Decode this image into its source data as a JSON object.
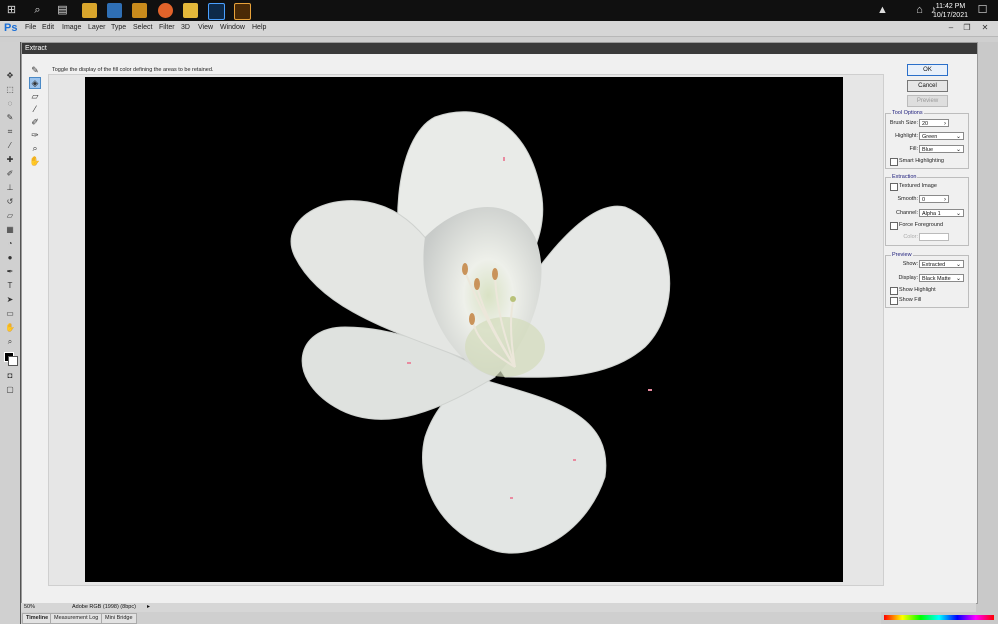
{
  "taskbar": {
    "time": "11:42 PM",
    "date": "10/17/2021"
  },
  "menubar": {
    "app_logo": "Ps",
    "items": [
      "File",
      "Edit",
      "Image",
      "Layer",
      "Type",
      "Select",
      "Filter",
      "3D",
      "View",
      "Window",
      "Help"
    ]
  },
  "dialog": {
    "title": "Extract",
    "hint": "Toggle the display of the fill color defining the areas to be retained.",
    "buttons": {
      "ok": "OK",
      "cancel": "Cancel",
      "preview": "Preview"
    },
    "tool_options": {
      "title": "Tool Options",
      "brush_size_label": "Brush Size:",
      "brush_size_value": "20",
      "highlight_label": "Highlight:",
      "highlight_value": "Green",
      "fill_label": "Fill:",
      "fill_value": "Blue",
      "smart_highlighting": "Smart Highlighting"
    },
    "extraction": {
      "title": "Extraction",
      "textured_image": "Textured Image",
      "smooth_label": "Smooth:",
      "smooth_value": "0",
      "channel_label": "Channel:",
      "channel_value": "Alpha 1",
      "force_foreground": "Force Foreground",
      "color_label": "Color:"
    },
    "preview_group": {
      "title": "Preview",
      "show_label": "Show:",
      "show_value": "Extracted",
      "display_label": "Display:",
      "display_value": "Black Matte",
      "show_highlight": "Show Highlight",
      "show_fill": "Show Fill"
    }
  },
  "statusbar": {
    "zoom": "50%",
    "profile": "Adobe RGB (1998) (8bpc)"
  },
  "bottom_tabs": [
    "Timeline",
    "Measurement Log",
    "Mini Bridge"
  ],
  "colors": {
    "taskbar": "#101010",
    "dialog_bg": "#f0f0f0",
    "canvas_bg": "#000000",
    "accent": "#2a6fc9"
  }
}
